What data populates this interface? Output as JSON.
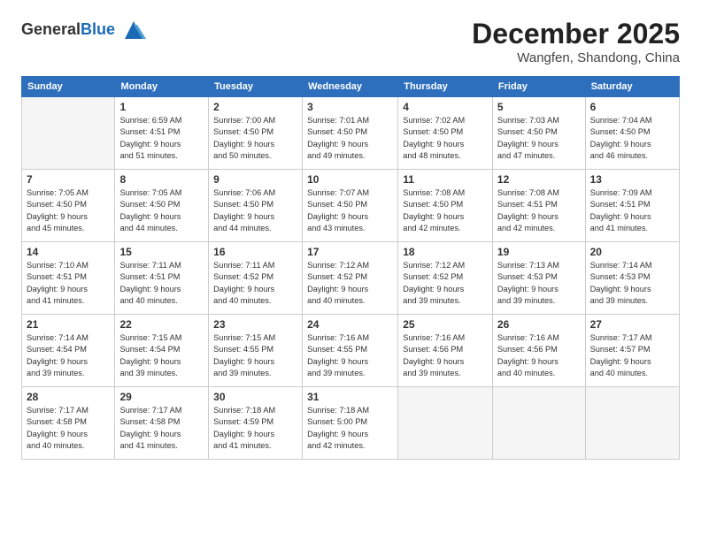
{
  "header": {
    "logo_general": "General",
    "logo_blue": "Blue",
    "month_title": "December 2025",
    "location": "Wangfen, Shandong, China"
  },
  "days_of_week": [
    "Sunday",
    "Monday",
    "Tuesday",
    "Wednesday",
    "Thursday",
    "Friday",
    "Saturday"
  ],
  "weeks": [
    [
      {
        "day": "",
        "info": ""
      },
      {
        "day": "1",
        "info": "Sunrise: 6:59 AM\nSunset: 4:51 PM\nDaylight: 9 hours\nand 51 minutes."
      },
      {
        "day": "2",
        "info": "Sunrise: 7:00 AM\nSunset: 4:50 PM\nDaylight: 9 hours\nand 50 minutes."
      },
      {
        "day": "3",
        "info": "Sunrise: 7:01 AM\nSunset: 4:50 PM\nDaylight: 9 hours\nand 49 minutes."
      },
      {
        "day": "4",
        "info": "Sunrise: 7:02 AM\nSunset: 4:50 PM\nDaylight: 9 hours\nand 48 minutes."
      },
      {
        "day": "5",
        "info": "Sunrise: 7:03 AM\nSunset: 4:50 PM\nDaylight: 9 hours\nand 47 minutes."
      },
      {
        "day": "6",
        "info": "Sunrise: 7:04 AM\nSunset: 4:50 PM\nDaylight: 9 hours\nand 46 minutes."
      }
    ],
    [
      {
        "day": "7",
        "info": "Sunrise: 7:05 AM\nSunset: 4:50 PM\nDaylight: 9 hours\nand 45 minutes."
      },
      {
        "day": "8",
        "info": "Sunrise: 7:05 AM\nSunset: 4:50 PM\nDaylight: 9 hours\nand 44 minutes."
      },
      {
        "day": "9",
        "info": "Sunrise: 7:06 AM\nSunset: 4:50 PM\nDaylight: 9 hours\nand 44 minutes."
      },
      {
        "day": "10",
        "info": "Sunrise: 7:07 AM\nSunset: 4:50 PM\nDaylight: 9 hours\nand 43 minutes."
      },
      {
        "day": "11",
        "info": "Sunrise: 7:08 AM\nSunset: 4:50 PM\nDaylight: 9 hours\nand 42 minutes."
      },
      {
        "day": "12",
        "info": "Sunrise: 7:08 AM\nSunset: 4:51 PM\nDaylight: 9 hours\nand 42 minutes."
      },
      {
        "day": "13",
        "info": "Sunrise: 7:09 AM\nSunset: 4:51 PM\nDaylight: 9 hours\nand 41 minutes."
      }
    ],
    [
      {
        "day": "14",
        "info": "Sunrise: 7:10 AM\nSunset: 4:51 PM\nDaylight: 9 hours\nand 41 minutes."
      },
      {
        "day": "15",
        "info": "Sunrise: 7:11 AM\nSunset: 4:51 PM\nDaylight: 9 hours\nand 40 minutes."
      },
      {
        "day": "16",
        "info": "Sunrise: 7:11 AM\nSunset: 4:52 PM\nDaylight: 9 hours\nand 40 minutes."
      },
      {
        "day": "17",
        "info": "Sunrise: 7:12 AM\nSunset: 4:52 PM\nDaylight: 9 hours\nand 40 minutes."
      },
      {
        "day": "18",
        "info": "Sunrise: 7:12 AM\nSunset: 4:52 PM\nDaylight: 9 hours\nand 39 minutes."
      },
      {
        "day": "19",
        "info": "Sunrise: 7:13 AM\nSunset: 4:53 PM\nDaylight: 9 hours\nand 39 minutes."
      },
      {
        "day": "20",
        "info": "Sunrise: 7:14 AM\nSunset: 4:53 PM\nDaylight: 9 hours\nand 39 minutes."
      }
    ],
    [
      {
        "day": "21",
        "info": "Sunrise: 7:14 AM\nSunset: 4:54 PM\nDaylight: 9 hours\nand 39 minutes."
      },
      {
        "day": "22",
        "info": "Sunrise: 7:15 AM\nSunset: 4:54 PM\nDaylight: 9 hours\nand 39 minutes."
      },
      {
        "day": "23",
        "info": "Sunrise: 7:15 AM\nSunset: 4:55 PM\nDaylight: 9 hours\nand 39 minutes."
      },
      {
        "day": "24",
        "info": "Sunrise: 7:16 AM\nSunset: 4:55 PM\nDaylight: 9 hours\nand 39 minutes."
      },
      {
        "day": "25",
        "info": "Sunrise: 7:16 AM\nSunset: 4:56 PM\nDaylight: 9 hours\nand 39 minutes."
      },
      {
        "day": "26",
        "info": "Sunrise: 7:16 AM\nSunset: 4:56 PM\nDaylight: 9 hours\nand 40 minutes."
      },
      {
        "day": "27",
        "info": "Sunrise: 7:17 AM\nSunset: 4:57 PM\nDaylight: 9 hours\nand 40 minutes."
      }
    ],
    [
      {
        "day": "28",
        "info": "Sunrise: 7:17 AM\nSunset: 4:58 PM\nDaylight: 9 hours\nand 40 minutes."
      },
      {
        "day": "29",
        "info": "Sunrise: 7:17 AM\nSunset: 4:58 PM\nDaylight: 9 hours\nand 41 minutes."
      },
      {
        "day": "30",
        "info": "Sunrise: 7:18 AM\nSunset: 4:59 PM\nDaylight: 9 hours\nand 41 minutes."
      },
      {
        "day": "31",
        "info": "Sunrise: 7:18 AM\nSunset: 5:00 PM\nDaylight: 9 hours\nand 42 minutes."
      },
      {
        "day": "",
        "info": ""
      },
      {
        "day": "",
        "info": ""
      },
      {
        "day": "",
        "info": ""
      }
    ]
  ]
}
